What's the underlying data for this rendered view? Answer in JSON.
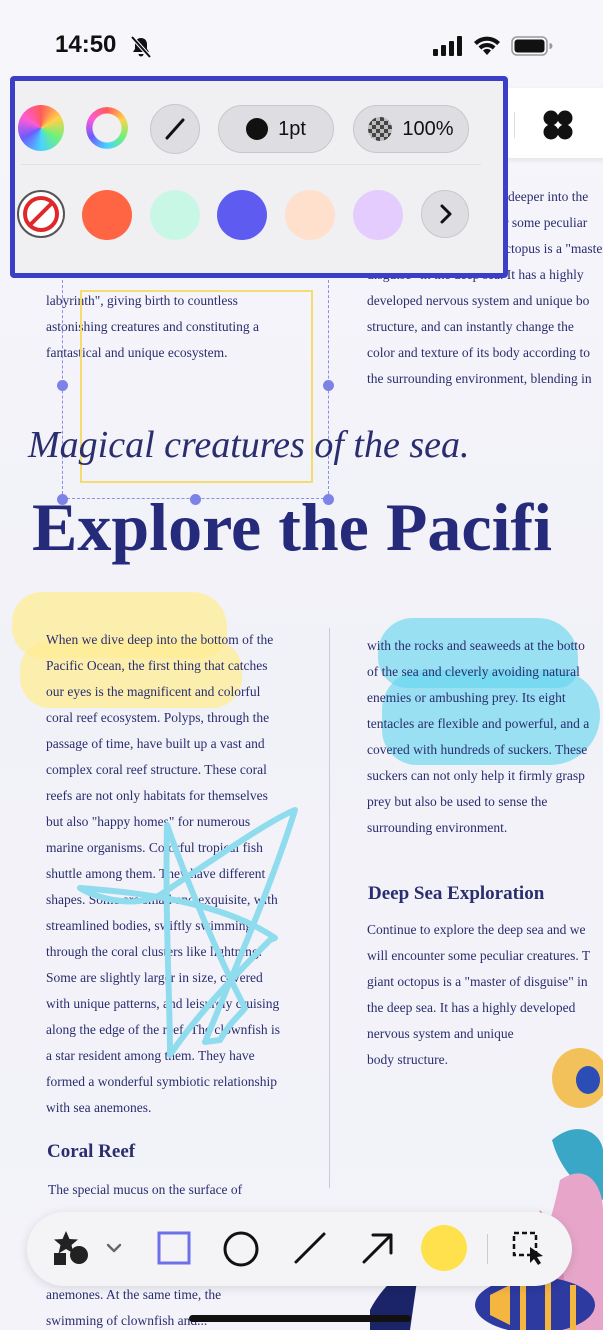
{
  "status_bar": {
    "time": "14:50"
  },
  "document": {
    "top_left_lines": [
      "labyrinth\", giving birth to countless",
      "astonishing creatures and constituting a",
      "fantastical and unique ecosystem."
    ],
    "top_right_lines": [
      "deeper into the",
      "r some peculiar",
      "ctopus is a \"master",
      "disguise\" in the deep sea. It has a highly",
      "developed nervous system and unique bo",
      "structure, and can instantly change the",
      "color and texture of its body according to",
      "the surrounding environment, blending in"
    ],
    "subtitle": "Magical creatures of the sea.",
    "title": "Explore the Pacifi",
    "left_main_lines": [
      "When we dive deep into the bottom of the",
      "Pacific Ocean, the first thing that catches",
      "our eyes is the magnificent and colorful",
      "coral reef ecosystem. Polyps, through the",
      "passage of time, have built up a vast and",
      "complex coral reef structure. These coral",
      "reefs are not only habitats for themselves",
      "but also \"happy homes\" for numerous",
      "marine organisms. Colorful tropical fish",
      "shuttle among them. They have different",
      "shapes. Some are small and exquisite, with",
      "streamlined bodies, swiftly swimming",
      "through the coral clusters like lightning.",
      "Some are slightly larger in size, covered",
      "with unique patterns, and leisurely cruising",
      "along the edge of the reef. The clownfish is",
      "a star resident among them. They have",
      "formed a wonderful symbiotic relationship",
      "with sea anemones."
    ],
    "right_main_lines": [
      "with the rocks and seaweeds at the botto",
      "of the sea and cleverly avoiding natural",
      "enemies or ambushing prey. Its eight",
      "tentacles are flexible and powerful, and a",
      "covered with hundreds of suckers. These",
      "suckers can not only help it firmly grasp",
      "prey but also be used to sense the",
      "surrounding environment."
    ],
    "deep_sea_heading": "Deep Sea Exploration",
    "deep_sea_lines": [
      "Continue to explore the deep sea and we",
      "will encounter some peculiar creatures. T",
      "giant octopus is a \"master of disguise\" in",
      "the deep sea. It has a highly developed",
      "nervous system and unique",
      "body structure."
    ],
    "coral_heading": "Coral Reef",
    "coral_lines": [
      "The special mucus on the surface of"
    ],
    "bottom_lines": [
      "anemones. At the same time, the",
      "swimming of clownfish and..."
    ]
  },
  "popover": {
    "stroke_width_label": "1pt",
    "opacity_label": "100%",
    "swatches": [
      "#ff6443",
      "#c9f7e6",
      "#5e5cf0",
      "#ffe0cc",
      "#e5ccff"
    ]
  },
  "bottom_toolbar": {
    "highlight_color": "#ffe14d",
    "tools": [
      "stamp-icon",
      "rectangle-icon",
      "ellipse-icon",
      "line-icon",
      "arrow-icon",
      "color-swatch",
      "select-tool-icon"
    ]
  }
}
